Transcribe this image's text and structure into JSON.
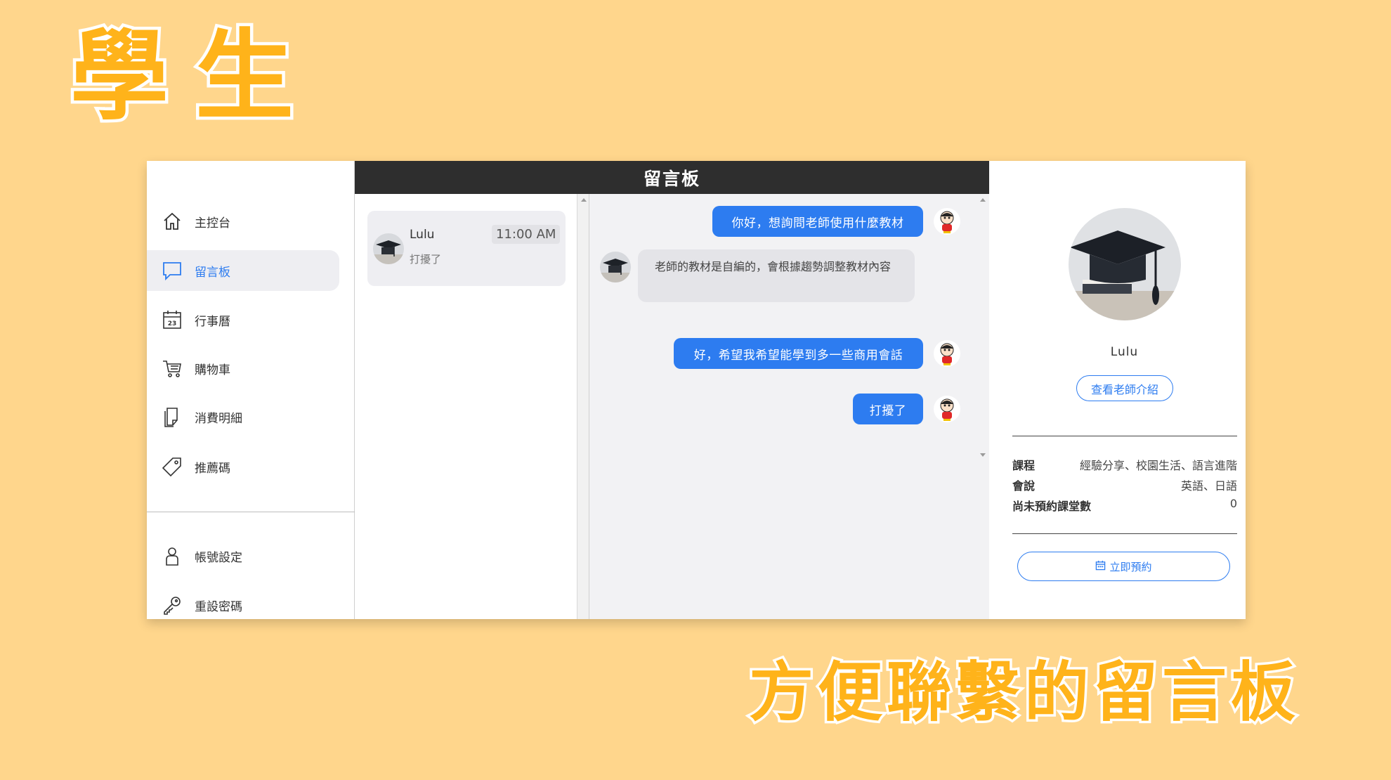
{
  "promo": {
    "title": "學生",
    "caption": "方便聯繫的留言板"
  },
  "sidebar": {
    "items": [
      {
        "label": "主控台",
        "icon": "home-icon"
      },
      {
        "label": "留言板",
        "icon": "chat-icon",
        "active": true
      },
      {
        "label": "行事曆",
        "icon": "calendar-icon",
        "badge": "23"
      },
      {
        "label": "購物車",
        "icon": "cart-icon"
      },
      {
        "label": "消費明細",
        "icon": "document-icon"
      },
      {
        "label": "推薦碼",
        "icon": "tag-icon"
      }
    ],
    "bottom_items": [
      {
        "label": "帳號設定",
        "icon": "user-icon"
      },
      {
        "label": "重設密碼",
        "icon": "key-icon"
      }
    ]
  },
  "header": {
    "title": "留言板"
  },
  "conversations": [
    {
      "name": "Lulu",
      "time": "11:00 AM",
      "preview": "打擾了"
    }
  ],
  "messages": [
    {
      "from": "me",
      "text": "你好，想詢問老師使用什麼教材"
    },
    {
      "from": "teacher",
      "text": "老師的教材是自編的，會根據趨勢調整教材內容"
    },
    {
      "from": "me",
      "text": "好，希望我希望能學到多一些商用會話"
    },
    {
      "from": "me",
      "text": "打擾了"
    }
  ],
  "profile": {
    "name": "Lulu",
    "intro_button": "查看老師介紹",
    "info": [
      {
        "key": "課程",
        "value": "經驗分享、校園生活、語言進階"
      },
      {
        "key": "會說",
        "value": "英語、日語"
      },
      {
        "key": "尚未預約課堂數",
        "value": "0"
      }
    ],
    "book_button": "立即預約"
  },
  "colors": {
    "background": "#FFD68C",
    "promo_text": "#FFB31A",
    "accent": "#2D7CF0",
    "header": "#2E2E2E"
  }
}
